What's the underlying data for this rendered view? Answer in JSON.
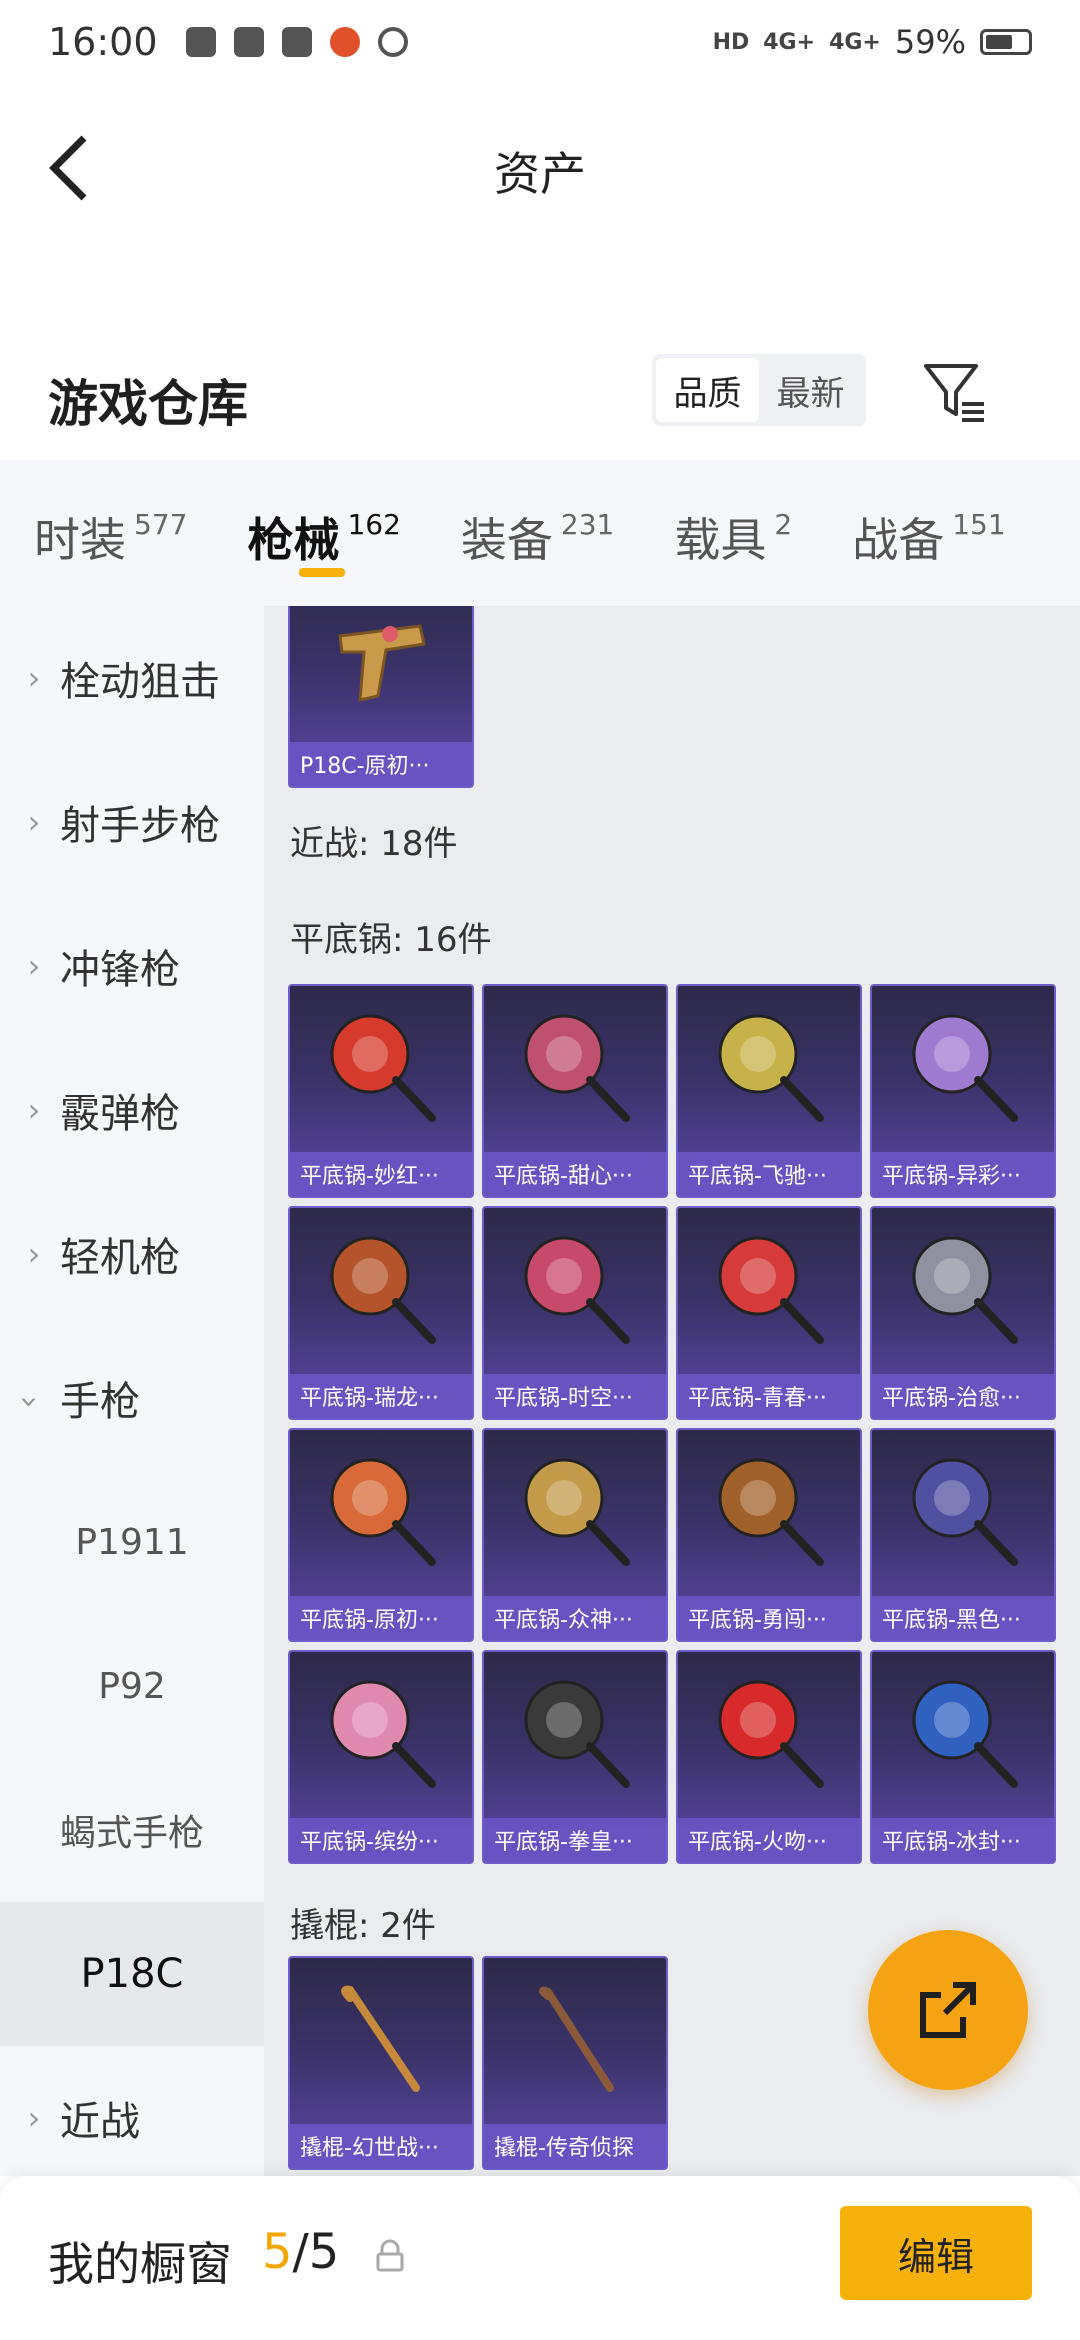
{
  "statusbar": {
    "time": "16:00",
    "signal1": "4G+",
    "signal2": "4G+",
    "hd": "HD",
    "battery": "59%"
  },
  "nav": {
    "title": "资产"
  },
  "warehouse": {
    "title": "游戏仓库",
    "sort_quality": "品质",
    "sort_newest": "最新"
  },
  "categories": [
    {
      "label": "时装",
      "count": "577"
    },
    {
      "label": "枪械",
      "count": "162"
    },
    {
      "label": "装备",
      "count": "231"
    },
    {
      "label": "载具",
      "count": "2"
    },
    {
      "label": "战备",
      "count": "151"
    }
  ],
  "sidebar": [
    {
      "label": "栓动狙击",
      "type": "group"
    },
    {
      "label": "射手步枪",
      "type": "group"
    },
    {
      "label": "冲锋枪",
      "type": "group"
    },
    {
      "label": "霰弹枪",
      "type": "group"
    },
    {
      "label": "轻机枪",
      "type": "group"
    },
    {
      "label": "手枪",
      "type": "group-open"
    },
    {
      "label": "P1911",
      "type": "sub"
    },
    {
      "label": "P92",
      "type": "sub"
    },
    {
      "label": "蝎式手枪",
      "type": "sub"
    },
    {
      "label": "P18C",
      "type": "sub-selected"
    },
    {
      "label": "近战",
      "type": "group"
    }
  ],
  "content": {
    "top_item": "P18C-原初···",
    "melee_label": "近战: 18件",
    "pan_label": "平底锅: 16件",
    "pans": [
      "平底锅-妙红···",
      "平底锅-甜心···",
      "平底锅-飞驰···",
      "平底锅-异彩···",
      "平底锅-瑞龙···",
      "平底锅-时空···",
      "平底锅-青春···",
      "平底锅-治愈···",
      "平底锅-原初···",
      "平底锅-众神···",
      "平底锅-勇闯···",
      "平底锅-黑色···",
      "平底锅-缤纷···",
      "平底锅-拳皇···",
      "平底锅-火吻···",
      "平底锅-冰封···"
    ],
    "crowbar_label": "撬棍: 2件",
    "crowbars": [
      "撬棍-幻世战···",
      "撬棍-传奇侦探"
    ]
  },
  "bottombar": {
    "label": "我的橱窗",
    "current": "5",
    "total": "/5",
    "edit": "编辑"
  },
  "colors": {
    "accent": "#f6b10c",
    "tile_bg": "#3a3268",
    "tile_caption": "#6c56c8",
    "fab": "#f6a313"
  }
}
